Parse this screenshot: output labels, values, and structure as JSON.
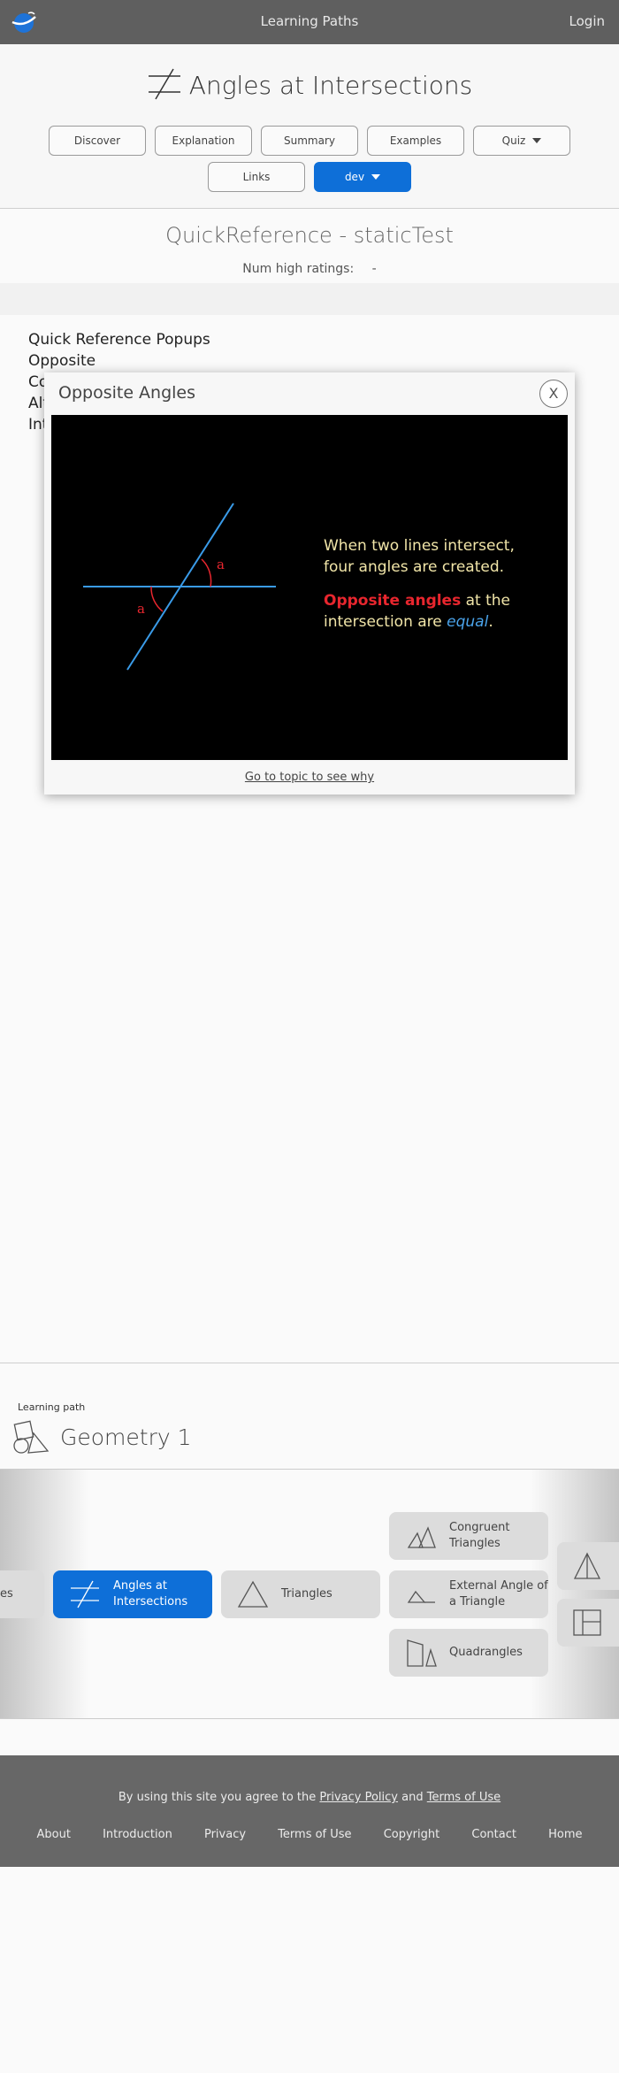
{
  "topbar": {
    "title": "Learning Paths",
    "login": "Login",
    "logo": "globe-logo"
  },
  "header": {
    "title": "Angles at Intersections",
    "buttons": [
      {
        "label": "Discover"
      },
      {
        "label": "Explanation"
      },
      {
        "label": "Summary"
      },
      {
        "label": "Examples"
      },
      {
        "label": "Quiz"
      },
      {
        "label": "Links"
      },
      {
        "label": "dev"
      }
    ]
  },
  "page": {
    "qr_title": "QuickReference - staticTest",
    "ratings_label": "Num high ratings:",
    "ratings_value": "-"
  },
  "popup_list": [
    "Quick Reference Popups",
    "Opposite",
    "Co",
    "Alt",
    "Int"
  ],
  "modal": {
    "title": "Opposite Angles",
    "close": "X",
    "line1": "When two lines intersect, four angles are created.",
    "red": "Opposite angles",
    "mid": " at the intersection are ",
    "blue": "equal",
    "end": ".",
    "angle_label_1": "a",
    "angle_label_2": "a",
    "link": "Go to topic to see why",
    "colors": {
      "horizontal_line": "#3a9be8",
      "angle_arc": "#e8262e",
      "text": "#f1e5a8"
    }
  },
  "learning_path": {
    "label": "Learning path",
    "title": "Geometry 1",
    "nodes": {
      "left_partial": "es",
      "active": "Angles at Intersections",
      "triangles": "Triangles",
      "congruent": "Congruent Triangles",
      "external": "External Angle of a Triangle",
      "quadrangles": "Quadrangles"
    }
  },
  "footer": {
    "agree_prefix": "By using this site you agree to the",
    "privacy_policy": "Privacy Policy",
    "and": "and",
    "terms": "Terms of Use",
    "links": [
      "About",
      "Introduction",
      "Privacy",
      "Terms of Use",
      "Copyright",
      "Contact",
      "Home"
    ]
  },
  "colors": {
    "accent": "#0e6fd8",
    "topbar": "#5f5f5f",
    "footer": "#676767"
  }
}
